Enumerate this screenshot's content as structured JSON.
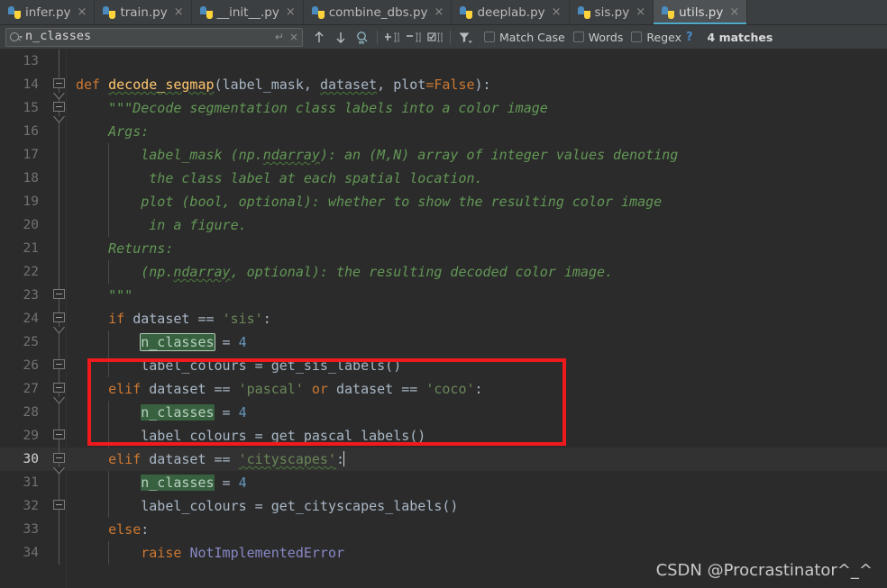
{
  "tabs": [
    {
      "label": "infer.py",
      "icon": "python-file-icon",
      "active": false,
      "close": "×"
    },
    {
      "label": "train.py",
      "icon": "python-file-icon",
      "active": false,
      "close": "×"
    },
    {
      "label": "__init__.py",
      "icon": "python-file-icon",
      "active": false,
      "close": "×"
    },
    {
      "label": "combine_dbs.py",
      "icon": "python-file-icon",
      "active": false,
      "close": "×"
    },
    {
      "label": "deeplab.py",
      "icon": "python-file-icon",
      "active": false,
      "close": "×"
    },
    {
      "label": "sis.py",
      "icon": "python-file-icon",
      "active": false,
      "close": "×"
    },
    {
      "label": "utils.py",
      "icon": "python-file-icon",
      "active": true,
      "close": "×"
    }
  ],
  "find_toolbar": {
    "search_value": "n_classes",
    "search_placeholder": "Search",
    "search_icon": "magnifier-icon",
    "enter_icon": "↵",
    "clear_icon": "×",
    "prev_icon": "↑",
    "next_icon": "↓",
    "select_all_occurrences_icon": "magnifier-select-all-icon",
    "add_selection_icon": "add-selection-icon",
    "remove_selection_icon": "remove-selection-icon",
    "select_all_carets_icon": "select-all-carets-icon",
    "filter_icon": "filter-icon",
    "options": [
      {
        "label": "Match Case",
        "mnemonic": "C",
        "checked": false
      },
      {
        "label": "Words",
        "mnemonic": "o",
        "checked": false
      },
      {
        "label": "Regex",
        "mnemonic": "x",
        "checked": false
      }
    ],
    "help_label": "?",
    "match_count": "4 matches"
  },
  "editor": {
    "caret_line": 30,
    "first_line": 13,
    "lines": [
      {
        "n": 13,
        "fold": "line",
        "indent": [],
        "tokens": []
      },
      {
        "n": 14,
        "fold": "box-down",
        "indent": [],
        "tokens": [
          {
            "t": "def ",
            "c": "kw"
          },
          {
            "t": "decode_segmap",
            "c": "fn wavy"
          },
          {
            "t": "(",
            "c": "id"
          },
          {
            "t": "label_mask",
            "c": "id"
          },
          {
            "t": ", ",
            "c": "id"
          },
          {
            "t": "dataset",
            "c": "id wavy"
          },
          {
            "t": ", ",
            "c": "id"
          },
          {
            "t": "plot",
            "c": "id"
          },
          {
            "t": "=",
            "c": "kw"
          },
          {
            "t": "False",
            "c": "kw"
          },
          {
            "t": "):",
            "c": "id"
          }
        ]
      },
      {
        "n": 15,
        "fold": "box-down",
        "indent": [],
        "tokens": [
          {
            "t": "    \"\"\"Decode segmentation class labels into a color image",
            "c": "doc"
          }
        ]
      },
      {
        "n": 16,
        "fold": "line",
        "indent": [],
        "tokens": [
          {
            "t": "    Args:",
            "c": "doc"
          }
        ]
      },
      {
        "n": 17,
        "fold": "line",
        "indent": [
          1
        ],
        "tokens": [
          {
            "t": "        label_mask (np.",
            "c": "doc"
          },
          {
            "t": "ndarray",
            "c": "doc wavy"
          },
          {
            "t": "): an (M,N) array of integer values denoting",
            "c": "doc"
          }
        ]
      },
      {
        "n": 18,
        "fold": "line",
        "indent": [
          1
        ],
        "tokens": [
          {
            "t": "         the class label at each spatial location.",
            "c": "doc"
          }
        ]
      },
      {
        "n": 19,
        "fold": "line",
        "indent": [
          1
        ],
        "tokens": [
          {
            "t": "        plot (bool, optional): whether to show the resulting color image",
            "c": "doc"
          }
        ]
      },
      {
        "n": 20,
        "fold": "line",
        "indent": [
          1
        ],
        "tokens": [
          {
            "t": "         in a figure.",
            "c": "doc"
          }
        ]
      },
      {
        "n": 21,
        "fold": "line",
        "indent": [],
        "tokens": [
          {
            "t": "    Returns:",
            "c": "doc"
          }
        ]
      },
      {
        "n": 22,
        "fold": "line",
        "indent": [
          1
        ],
        "tokens": [
          {
            "t": "        (np.",
            "c": "doc"
          },
          {
            "t": "ndarray",
            "c": "doc wavy"
          },
          {
            "t": ", optional): the resulting decoded color image.",
            "c": "doc"
          }
        ]
      },
      {
        "n": 23,
        "fold": "box-up",
        "indent": [],
        "tokens": [
          {
            "t": "    \"\"\"",
            "c": "doc"
          }
        ]
      },
      {
        "n": 24,
        "fold": "box-down",
        "indent": [],
        "tokens": [
          {
            "t": "    if ",
            "c": "kw"
          },
          {
            "t": "dataset ",
            "c": "id"
          },
          {
            "t": "== ",
            "c": "id"
          },
          {
            "t": "'sis'",
            "c": "str"
          },
          {
            "t": ":",
            "c": "id"
          }
        ]
      },
      {
        "n": 25,
        "fold": "line",
        "indent": [
          1
        ],
        "tokens": [
          {
            "t": "        ",
            "c": "id"
          },
          {
            "t": "n_classes",
            "c": "match current"
          },
          {
            "t": " = ",
            "c": "id"
          },
          {
            "t": "4",
            "c": "num"
          }
        ]
      },
      {
        "n": 26,
        "fold": "box-up",
        "indent": [
          1
        ],
        "tokens": [
          {
            "t": "        label_colours = get_sis_labels()",
            "c": "id"
          }
        ]
      },
      {
        "n": 27,
        "fold": "box-down",
        "indent": [],
        "tokens": [
          {
            "t": "    elif ",
            "c": "kw"
          },
          {
            "t": "dataset ",
            "c": "id"
          },
          {
            "t": "== ",
            "c": "id"
          },
          {
            "t": "'pascal'",
            "c": "str"
          },
          {
            "t": " ",
            "c": "id"
          },
          {
            "t": "or",
            "c": "kw"
          },
          {
            "t": " dataset ",
            "c": "id"
          },
          {
            "t": "== ",
            "c": "id"
          },
          {
            "t": "'coco'",
            "c": "str"
          },
          {
            "t": ":",
            "c": "id"
          }
        ]
      },
      {
        "n": 28,
        "fold": "line",
        "indent": [
          1
        ],
        "tokens": [
          {
            "t": "        ",
            "c": "id"
          },
          {
            "t": "n_classes",
            "c": "match"
          },
          {
            "t": " = ",
            "c": "id"
          },
          {
            "t": "4",
            "c": "num"
          }
        ]
      },
      {
        "n": 29,
        "fold": "box-up",
        "indent": [
          1
        ],
        "tokens": [
          {
            "t": "        label_colours = get_pascal_labels()",
            "c": "id"
          }
        ]
      },
      {
        "n": 30,
        "fold": "box-down",
        "indent": [],
        "tokens": [
          {
            "t": "    elif ",
            "c": "kw"
          },
          {
            "t": "dataset ",
            "c": "id"
          },
          {
            "t": "== ",
            "c": "id"
          },
          {
            "t": "'cityscapes'",
            "c": "str wavy"
          },
          {
            "t": ":",
            "c": "id"
          },
          {
            "t": "|caret|",
            "c": "caret"
          }
        ]
      },
      {
        "n": 31,
        "fold": "line",
        "indent": [
          1
        ],
        "tokens": [
          {
            "t": "        ",
            "c": "id"
          },
          {
            "t": "n_classes",
            "c": "match"
          },
          {
            "t": " = ",
            "c": "id"
          },
          {
            "t": "4",
            "c": "num"
          }
        ]
      },
      {
        "n": 32,
        "fold": "box-up",
        "indent": [
          1
        ],
        "tokens": [
          {
            "t": "        label_colours = get_cityscapes_labels()",
            "c": "id"
          }
        ]
      },
      {
        "n": 33,
        "fold": "line",
        "indent": [],
        "tokens": [
          {
            "t": "    else",
            "c": "kw"
          },
          {
            "t": ":",
            "c": "id"
          }
        ]
      },
      {
        "n": 34,
        "fold": "line",
        "indent": [
          1
        ],
        "tokens": [
          {
            "t": "        raise ",
            "c": "kw"
          },
          {
            "t": "NotImplementedError",
            "c": "cls"
          }
        ]
      }
    ]
  },
  "annotation": {
    "shape": "red-rectangle",
    "color": "#f0191c"
  },
  "watermark": "CSDN @Procrastinator^_^"
}
